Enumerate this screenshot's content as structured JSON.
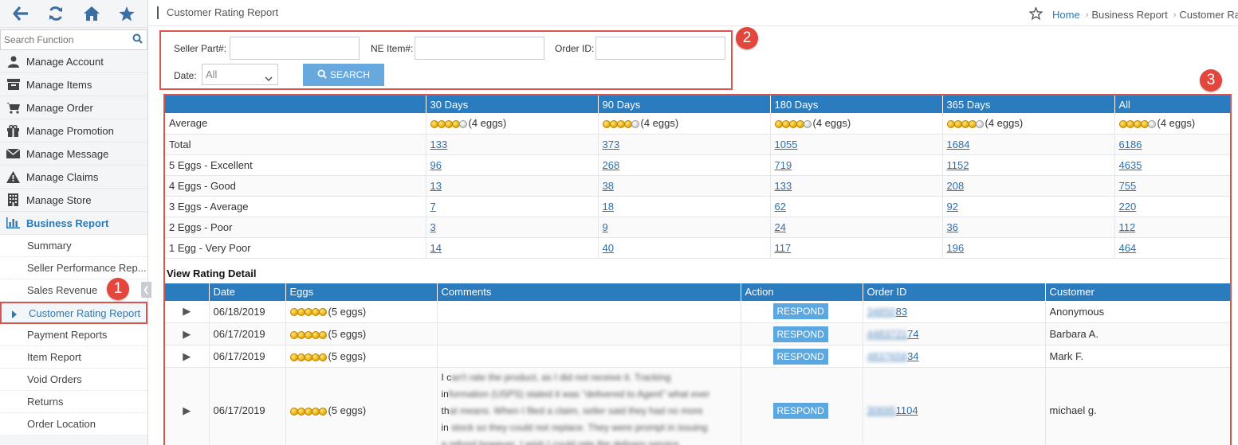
{
  "sidebar": {
    "search_placeholder": "Search Function",
    "menu": [
      {
        "label": "Manage Account"
      },
      {
        "label": "Manage Items"
      },
      {
        "label": "Manage Order"
      },
      {
        "label": "Manage Promotion"
      },
      {
        "label": "Manage Message"
      },
      {
        "label": "Manage Claims"
      },
      {
        "label": "Manage Store"
      },
      {
        "label": "Business Report"
      }
    ],
    "submenu": [
      {
        "label": "Summary"
      },
      {
        "label": "Seller Performance Rep..."
      },
      {
        "label": "Sales Revenue"
      },
      {
        "label": "Customer Rating Report"
      },
      {
        "label": "Payment Reports"
      },
      {
        "label": "Item Report"
      },
      {
        "label": "Void Orders"
      },
      {
        "label": "Returns"
      },
      {
        "label": "Order Location"
      }
    ]
  },
  "header": {
    "title": "Customer Rating Report",
    "breadcrumb": {
      "home": "Home",
      "section": "Business Report",
      "current": "Customer Ra"
    }
  },
  "filter": {
    "seller_part_label": "Seller Part#:",
    "ne_item_label": "NE Item#:",
    "order_id_label": "Order ID:",
    "date_label": "Date:",
    "date_value": "All",
    "search_label": "SEARCH"
  },
  "badges": [
    "1",
    "2",
    "3"
  ],
  "summary": {
    "headers": [
      "",
      "30 Days",
      "90 Days",
      "180 Days",
      "365 Days",
      "All"
    ],
    "average_label": "Average",
    "average_text": "(4 eggs)",
    "rows": [
      {
        "label": "Total",
        "values": [
          "133",
          "373",
          "1055",
          "1684",
          "6186"
        ]
      },
      {
        "label": "5 Eggs - Excellent",
        "values": [
          "96",
          "268",
          "719",
          "1152",
          "4635"
        ]
      },
      {
        "label": "4 Eggs - Good",
        "values": [
          "13",
          "38",
          "133",
          "208",
          "755"
        ]
      },
      {
        "label": "3 Eggs - Average",
        "values": [
          "7",
          "18",
          "62",
          "92",
          "220"
        ]
      },
      {
        "label": "2 Eggs - Poor",
        "values": [
          "3",
          "9",
          "24",
          "36",
          "112"
        ]
      },
      {
        "label": "1 Egg - Very Poor",
        "values": [
          "14",
          "40",
          "117",
          "196",
          "464"
        ]
      }
    ]
  },
  "detail": {
    "title": "View Rating Detail",
    "headers": [
      "",
      "Date",
      "Eggs",
      "Comments",
      "Action",
      "Order ID",
      "Customer"
    ],
    "respond_label": "RESPOND",
    "rows": [
      {
        "date": "06/18/2019",
        "eggs_text": "(5 eggs)",
        "comment_lines": [],
        "order_blur": "34850",
        "order_tail": "83",
        "customer": "Anonymous"
      },
      {
        "date": "06/17/2019",
        "eggs_text": "(5 eggs)",
        "comment_lines": [],
        "order_blur": "4483721",
        "order_tail": "74",
        "customer": "Barbara A."
      },
      {
        "date": "06/17/2019",
        "eggs_text": "(5 eggs)",
        "comment_lines": [],
        "order_blur": "4837658",
        "order_tail": "34",
        "customer": "Mark F."
      },
      {
        "date": "06/17/2019",
        "eggs_text": "(5 eggs)",
        "comment_lines": [
          {
            "clear": "I c",
            "blur": "an't rate the product, as I did not receive it. Tracking"
          },
          {
            "clear": "in",
            "blur": "formation (USPS) stated it was \"delivered to Agent\" what ever"
          },
          {
            "clear": "th",
            "blur": "at means. When I filed a claim, seller said they had no more"
          },
          {
            "clear": "in",
            "blur": " stock so they could not replace. They were prompt in issuing"
          },
          {
            "clear": "",
            "blur": "a refund however. I wish I could rate the delivery service."
          }
        ],
        "order_blur": "30695",
        "order_tail": "1104",
        "customer": "michael g."
      }
    ]
  }
}
